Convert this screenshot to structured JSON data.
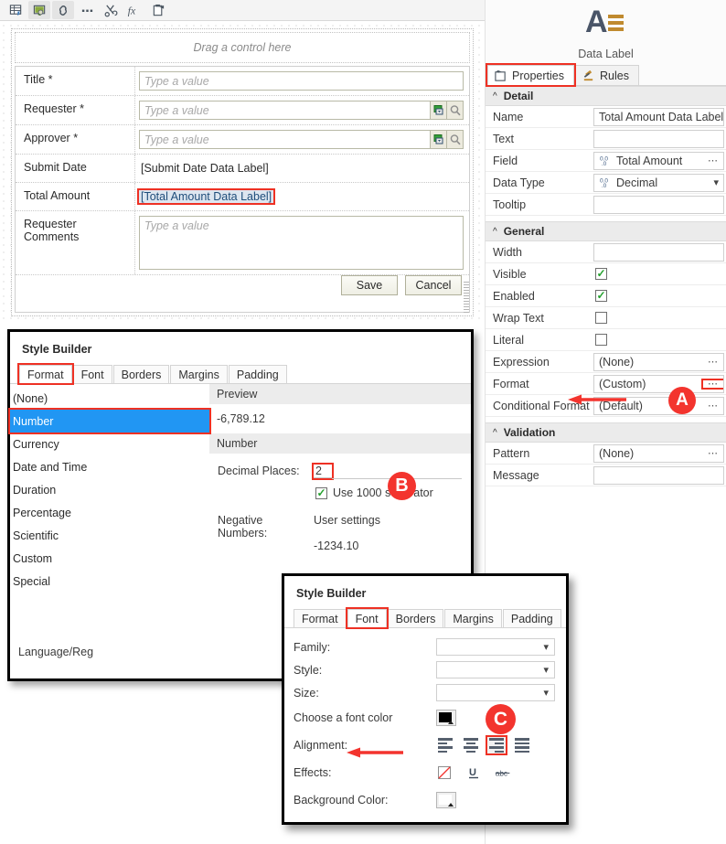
{
  "toolbar": {
    "buttons": [
      {
        "name": "insert-table-icon",
        "label": "Insert Table"
      },
      {
        "name": "image-icon",
        "label": "Image"
      },
      {
        "name": "link-icon",
        "label": "Link"
      },
      {
        "name": "more-icon",
        "label": "More"
      },
      {
        "name": "cut-icon",
        "label": "Cut"
      },
      {
        "name": "function-icon",
        "label": "fx"
      },
      {
        "name": "paste-icon",
        "label": "Paste"
      }
    ]
  },
  "canvas": {
    "drag_hint": "Drag a control here",
    "rows": [
      {
        "label": "Title *",
        "type": "input",
        "placeholder": "Type a value",
        "lookup": false
      },
      {
        "label": "Requester *",
        "type": "input",
        "placeholder": "Type a value",
        "lookup": true
      },
      {
        "label": "Approver *",
        "type": "input",
        "placeholder": "Type a value",
        "lookup": true
      },
      {
        "label": "Submit Date",
        "type": "text",
        "value": "[Submit Date Data Label]"
      },
      {
        "label": "Total Amount",
        "type": "selected-text",
        "value": "[Total Amount Data Label]"
      },
      {
        "label": "Requester Comments",
        "type": "textarea",
        "placeholder": "Type a value"
      }
    ],
    "save_label": "Save",
    "cancel_label": "Cancel"
  },
  "properties": {
    "control_title": "Data Label",
    "tabs": [
      {
        "label": "Properties",
        "icon": "properties-icon",
        "active": true
      },
      {
        "label": "Rules",
        "icon": "gavel-icon",
        "active": false
      }
    ],
    "sections": [
      {
        "title": "Detail",
        "rows": [
          {
            "label": "Name",
            "value": "Total Amount Data Label",
            "kind": "text"
          },
          {
            "label": "Text",
            "value": "",
            "kind": "text"
          },
          {
            "label": "Field",
            "value": "Total Amount",
            "kind": "field-ellipsis"
          },
          {
            "label": "Data Type",
            "value": "Decimal",
            "kind": "field-dropdown"
          },
          {
            "label": "Tooltip",
            "value": "",
            "kind": "text"
          }
        ]
      },
      {
        "title": "General",
        "rows": [
          {
            "label": "Width",
            "value": "",
            "kind": "text"
          },
          {
            "label": "Visible",
            "value": "",
            "kind": "checkbox",
            "checked": true
          },
          {
            "label": "Enabled",
            "value": "",
            "kind": "checkbox",
            "checked": true
          },
          {
            "label": "Wrap Text",
            "value": "",
            "kind": "checkbox",
            "checked": false
          },
          {
            "label": "Literal",
            "value": "",
            "kind": "checkbox",
            "checked": false
          },
          {
            "label": "Expression",
            "value": "(None)",
            "kind": "ellipsis"
          },
          {
            "label": "Format",
            "value": "(Custom)",
            "kind": "ellipsis-highlight"
          },
          {
            "label": "Conditional Format",
            "value": "(Default)",
            "kind": "ellipsis"
          }
        ]
      },
      {
        "title": "Validation",
        "rows": [
          {
            "label": "Pattern",
            "value": "(None)",
            "kind": "ellipsis"
          },
          {
            "label": "Message",
            "value": "",
            "kind": "text"
          }
        ]
      }
    ]
  },
  "style_builder_format": {
    "title": "Style Builder",
    "tabs": [
      "Format",
      "Font",
      "Borders",
      "Margins",
      "Padding"
    ],
    "active_tab": "Format",
    "categories": [
      "(None)",
      "Number",
      "Currency",
      "Date and Time",
      "Duration",
      "Percentage",
      "Scientific",
      "Custom",
      "Special"
    ],
    "selected_category": "Number",
    "preview_header": "Preview",
    "preview_value": "-6,789.12",
    "number_header": "Number",
    "decimal_places_label": "Decimal Places:",
    "decimal_places_value": "2",
    "use_1000_separator_label": "Use 1000 separator",
    "use_1000_separator_checked": true,
    "negative_numbers_label": "Negative Numbers:",
    "negative_option_1": "User settings",
    "negative_option_2": "-1234.10",
    "language_label": "Language/Reg"
  },
  "style_builder_font": {
    "title": "Style Builder",
    "tabs": [
      "Format",
      "Font",
      "Borders",
      "Margins",
      "Padding"
    ],
    "active_tab": "Font",
    "rows": [
      {
        "label": "Family:",
        "value": ""
      },
      {
        "label": "Style:",
        "value": ""
      },
      {
        "label": "Size:",
        "value": ""
      }
    ],
    "font_color_label": "Choose a font color",
    "font_color_value": "#000000",
    "alignment_label": "Alignment:",
    "alignment_options": [
      "left",
      "center",
      "right",
      "justify"
    ],
    "alignment_selected": "right",
    "effects_label": "Effects:",
    "effects_options": [
      "no-color",
      "underline",
      "strikethrough"
    ],
    "background_color_label": "Background Color:",
    "background_color_value": "#ffffff"
  },
  "annotations": {
    "accent_color": "#f3342e",
    "markers": [
      {
        "id": "A",
        "target": "format-ellipsis-button"
      },
      {
        "id": "B",
        "target": "decimal-places-input"
      },
      {
        "id": "C",
        "target": "alignment-right-button"
      }
    ]
  }
}
